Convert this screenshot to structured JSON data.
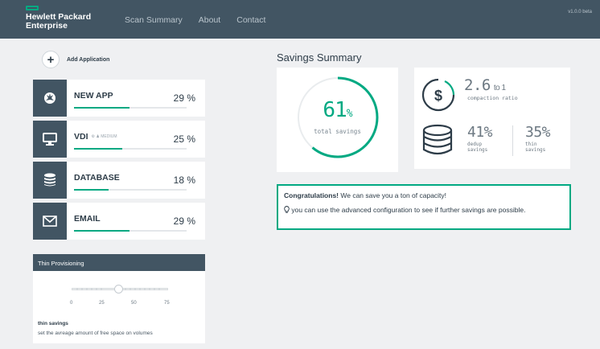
{
  "header": {
    "brand_line1": "Hewlett Packard",
    "brand_line2": "Enterprise",
    "nav": [
      "Scan Summary",
      "About",
      "Contact"
    ],
    "version": "v1.0.0 beta"
  },
  "add_app": {
    "label": "Add Application",
    "icon": "plus-icon"
  },
  "apps": [
    {
      "name": "NEW APP",
      "tag": "",
      "pct_label": "29 %",
      "pct": 29,
      "icon": "rebel-icon"
    },
    {
      "name": "VDI",
      "tag": "⚙ ♟ MEDIUM",
      "pct_label": "25 %",
      "pct": 25,
      "icon": "monitor-icon"
    },
    {
      "name": "DATABASE",
      "tag": "",
      "pct_label": "18 %",
      "pct": 18,
      "icon": "database-icon"
    },
    {
      "name": "EMAIL",
      "tag": "",
      "pct_label": "29 %",
      "pct": 29,
      "icon": "mail-icon"
    }
  ],
  "thin": {
    "header": "Thin Provisioning",
    "ticks": [
      "0",
      "25",
      "50",
      "75"
    ],
    "value": 35,
    "title": "thin savings",
    "desc": "set the avreage amount of free space on volumes"
  },
  "summary": {
    "title": "Savings Summary",
    "total_pct": "61",
    "total_pct_unit": "%",
    "total_label": "total savings",
    "total_fraction": 0.61,
    "ratio_value": "2.6",
    "ratio_suffix": "to 1",
    "ratio_label": "compaction ratio",
    "dedup_pct": "41%",
    "dedup_label_1": "dedup",
    "dedup_label_2": "savings",
    "thin_pct": "35%",
    "thin_label_1": "thin",
    "thin_label_2": "savings",
    "accent": "#01a982"
  },
  "congrats": {
    "bold": "Congratulations!",
    "line1_rest": " We can save you a ton of capacity!",
    "line2": " you can use the advanced configuration to see if further savings are possible."
  }
}
